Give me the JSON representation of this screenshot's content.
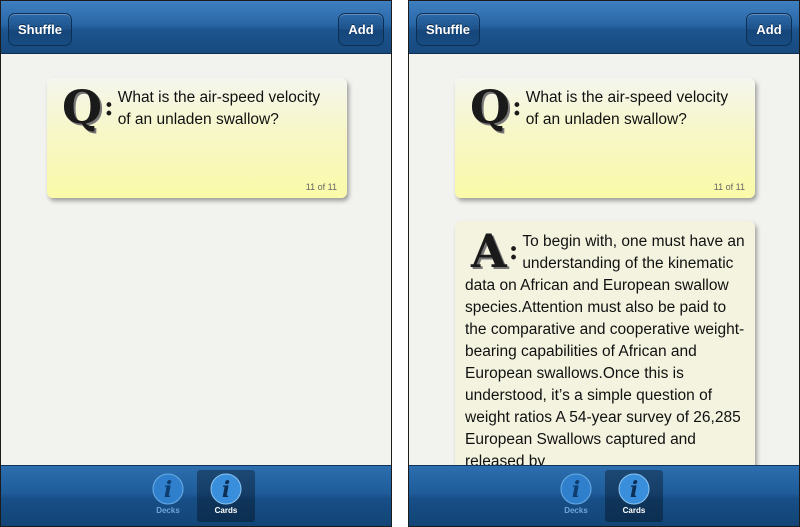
{
  "toolbar": {
    "shuffle_label": "Shuffle",
    "add_label": "Add"
  },
  "question_card": {
    "marker": "Q",
    "colon": ":",
    "text": "What is the air-speed velocity of an unladen swallow?",
    "counter": "11 of 11"
  },
  "answer_card": {
    "marker": "A",
    "colon": ":",
    "text": "To begin with, one must have an understanding of the kinematic data on African and European swallow species.Attention must also be paid to the comparative and cooperative weight-bearing capabilities of African and European swallows.Once this is understood, it’s a simple question of weight ratios A 54-year survey of 26,285 European Swallows captured and released by"
  },
  "tabbar": {
    "tabs": [
      {
        "label": "Decks",
        "icon": "info-icon",
        "selected": false
      },
      {
        "label": "Cards",
        "icon": "info-icon",
        "selected": true
      }
    ]
  },
  "colors": {
    "bar_blue": "#1f5c99",
    "question_card_bg": "#fbfaa8",
    "answer_card_bg": "#f3f3df",
    "screen_bg": "#f2f2ef"
  }
}
